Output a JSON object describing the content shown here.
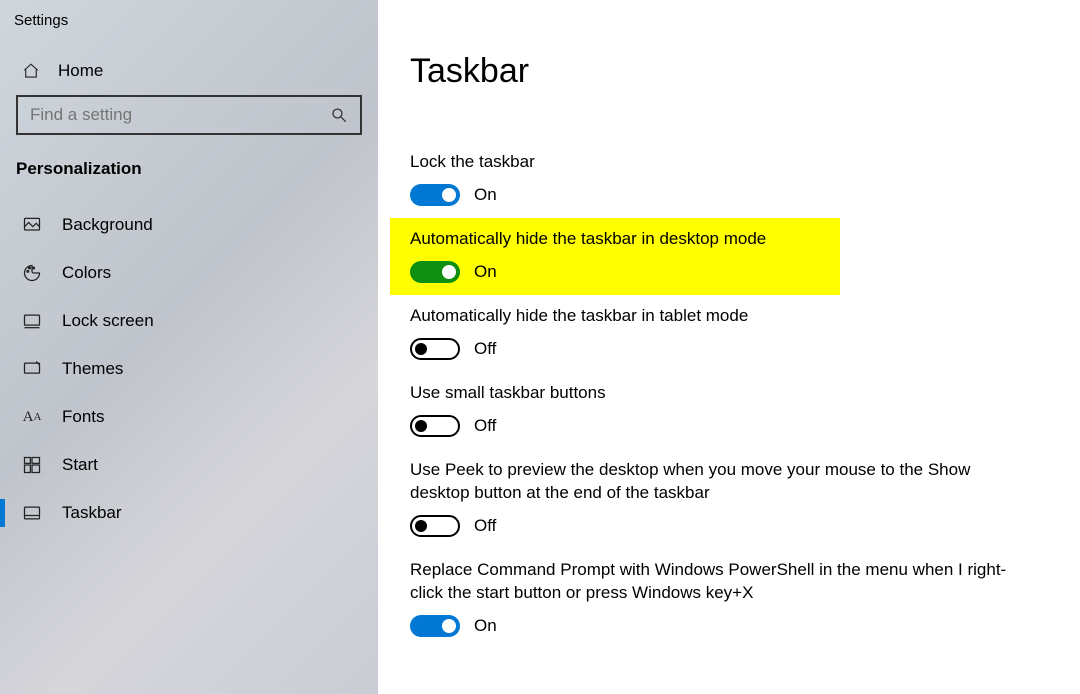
{
  "app_title": "Settings",
  "home_label": "Home",
  "search": {
    "placeholder": "Find a setting"
  },
  "section": "Personalization",
  "nav": [
    {
      "key": "background",
      "label": "Background",
      "selected": false
    },
    {
      "key": "colors",
      "label": "Colors",
      "selected": false
    },
    {
      "key": "lockscreen",
      "label": "Lock screen",
      "selected": false
    },
    {
      "key": "themes",
      "label": "Themes",
      "selected": false
    },
    {
      "key": "fonts",
      "label": "Fonts",
      "selected": false
    },
    {
      "key": "start",
      "label": "Start",
      "selected": false
    },
    {
      "key": "taskbar",
      "label": "Taskbar",
      "selected": true
    }
  ],
  "page_title": "Taskbar",
  "settings": {
    "lock": {
      "label": "Lock the taskbar",
      "state": "On",
      "on": true,
      "style": "blue"
    },
    "autohide_desktop": {
      "label": "Automatically hide the taskbar in desktop mode",
      "state": "On",
      "on": true,
      "style": "green",
      "highlight": true
    },
    "autohide_tablet": {
      "label": "Automatically hide the taskbar in tablet mode",
      "state": "Off",
      "on": false
    },
    "small_buttons": {
      "label": "Use small taskbar buttons",
      "state": "Off",
      "on": false
    },
    "peek": {
      "label": "Use Peek to preview the desktop when you move your mouse to the Show desktop button at the end of the taskbar",
      "state": "Off",
      "on": false
    },
    "powershell": {
      "label": "Replace Command Prompt with Windows PowerShell in the menu when I right-click the start button or press Windows key+X",
      "state": "On",
      "on": true,
      "style": "blue"
    }
  }
}
